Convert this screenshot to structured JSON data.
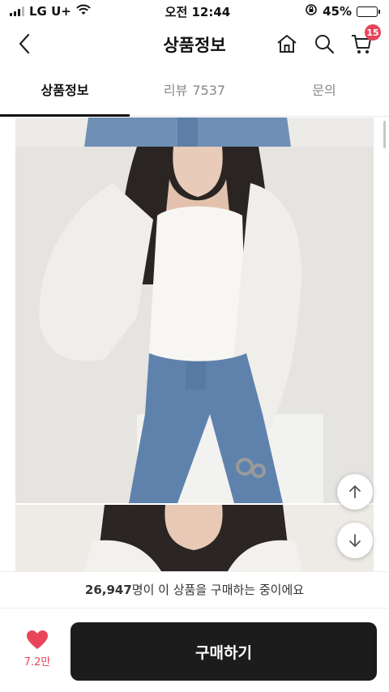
{
  "status": {
    "carrier": "LG U+",
    "time": "오전 12:44",
    "battery_pct": "45%",
    "battery_level": 0.45
  },
  "nav": {
    "title": "상품정보",
    "cart_count": "15"
  },
  "tabs": [
    {
      "label": "상품정보",
      "active": true
    },
    {
      "label": "리뷰",
      "count": "7537",
      "active": false
    },
    {
      "label": "문의",
      "active": false
    }
  ],
  "banner": {
    "count": "26,947",
    "text": "명이 이 상품을 구매하는 중이에요"
  },
  "bottom": {
    "like_count": "7.2만",
    "buy_label": "구매하기"
  },
  "colors": {
    "accent": "#e9455a",
    "buy_button": "#1c1c1c"
  }
}
